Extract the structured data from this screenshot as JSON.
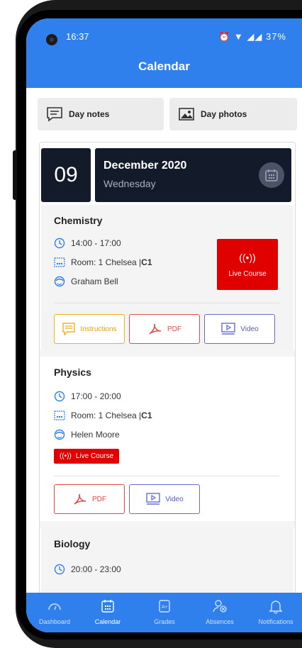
{
  "status": {
    "time": "16:37",
    "battery": "37%"
  },
  "header": {
    "title": "Calendar"
  },
  "tiles": {
    "notes": "Day notes",
    "photos": "Day photos"
  },
  "date": {
    "day": "09",
    "month": "December 2020",
    "weekday": "Wednesday"
  },
  "courses": [
    {
      "name": "Chemistry",
      "time": "14:00 - 17:00",
      "room": "Room: 1 Chelsea | ",
      "room_code": "C1",
      "teacher": "Graham Bell",
      "live": "Live Course",
      "actions": [
        "Instructions",
        "PDF",
        "Video"
      ]
    },
    {
      "name": "Physics",
      "time": "17:00 - 20:00",
      "room": "Room: 1 Chelsea | ",
      "room_code": "C1",
      "teacher": "Helen Moore",
      "live": "Live Course",
      "actions": [
        "PDF",
        "Video"
      ]
    },
    {
      "name": "Biology",
      "time": "20:00 - 23:00"
    }
  ],
  "nav": [
    {
      "label": "Dashboard"
    },
    {
      "label": "Calendar"
    },
    {
      "label": "Grades"
    },
    {
      "label": "Absences"
    },
    {
      "label": "Notifications"
    }
  ],
  "colors": {
    "primary": "#2f80ed",
    "live": "#e00000",
    "instructions": "#f2b01e",
    "pdf": "#e34a4a",
    "video": "#6a6ad6",
    "dark": "#131b2a"
  }
}
